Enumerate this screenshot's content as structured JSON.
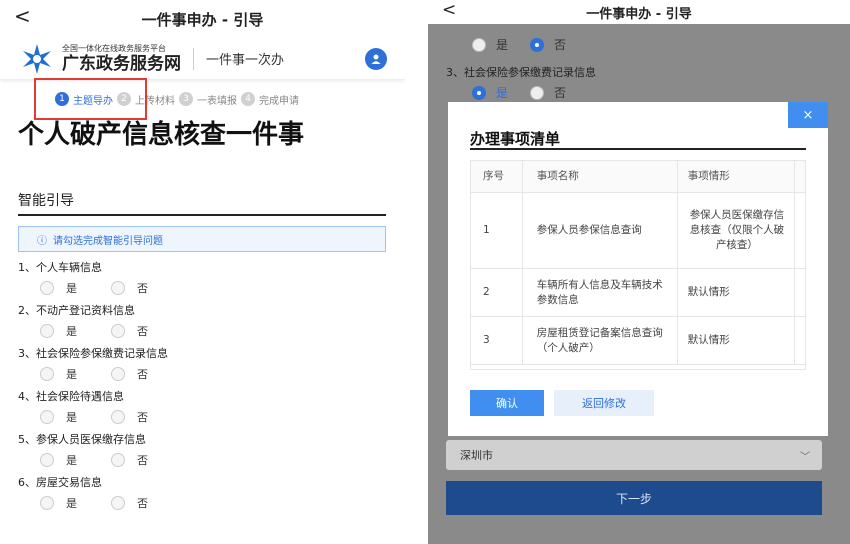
{
  "left": {
    "topbar": {
      "back": "<",
      "title": "一件事申办 - 引导"
    },
    "brand": {
      "small": "全国一体化在线政务服务平台",
      "big": "广东政务服务网",
      "sub": "一件事一次办"
    },
    "steps": [
      {
        "num": "1",
        "label": "主题导办"
      },
      {
        "num": "2",
        "label": "上传材料"
      },
      {
        "num": "3",
        "label": "一表填报"
      },
      {
        "num": "4",
        "label": "完成申请"
      }
    ],
    "main_title": "个人破产信息核查一件事",
    "section_title": "智能引导",
    "notice": "请勾选完成智能引导问题",
    "notice_icon": "ⓘ",
    "option_yes": "是",
    "option_no": "否",
    "questions": [
      "1、个人车辆信息",
      "2、不动产登记资料信息",
      "3、社会保险参保缴费记录信息",
      "4、社会保险待遇信息",
      "5、参保人员医保缴存信息",
      "6、房屋交易信息"
    ]
  },
  "right": {
    "topbar": {
      "back": "<",
      "title": "一件事申办 - 引导"
    },
    "q3": "3、社会保险参保缴费记录信息",
    "opt_yes": "是",
    "opt_no": "否",
    "modal": {
      "close": "×",
      "title": "办理事项清单",
      "headers": [
        "序号",
        "事项名称",
        "事项情形"
      ],
      "rows": [
        {
          "no": "1",
          "name": "参保人员参保信息查询",
          "case": "参保人员医保缴存信息核查（仅限个人破产核查）"
        },
        {
          "no": "2",
          "name": "车辆所有人信息及车辆技术参数信息",
          "case": "默认情形"
        },
        {
          "no": "3",
          "name": "房屋租赁登记备案信息查询（个人破产）",
          "case": "默认情形"
        }
      ],
      "confirm": "确认",
      "back": "返回修改"
    },
    "city": "深圳市",
    "next": "下一步"
  },
  "colors": {
    "primary": "#2f6fd8",
    "highlight_box": "#e53935",
    "overlay": "#8a8a8a"
  }
}
